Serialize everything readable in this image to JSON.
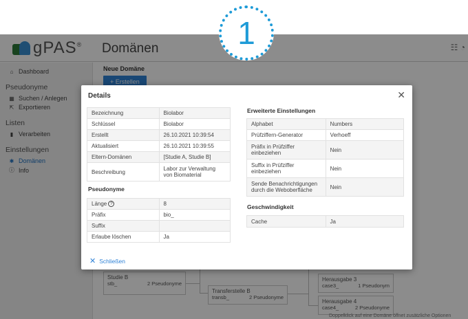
{
  "badge": {
    "number": "1"
  },
  "app": {
    "logo_text": "gPAS",
    "logo_reg": "®",
    "page_title": "Domänen"
  },
  "sidebar": {
    "dashboard": "Dashboard",
    "pseudonyme_section": "Pseudonyme",
    "suchen_anlegen": "Suchen / Anlegen",
    "exportieren": "Exportieren",
    "listen_section": "Listen",
    "verarbeiten": "Verarbeiten",
    "einstellungen_section": "Einstellungen",
    "domaenen": "Domänen",
    "info": "Info"
  },
  "main": {
    "new_domain": "Neue Domäne",
    "create_button": "Erstellen"
  },
  "graph": {
    "studie_b": {
      "name": "Studie B",
      "key": "stb_",
      "count": "2 Pseudonyme"
    },
    "transferstelle_b": {
      "name": "Transferstelle B",
      "key": "transb_",
      "count": "2 Pseudonyme"
    },
    "herausgabe3": {
      "name": "Herausgabe 3",
      "key": "case3_",
      "count": "1 Pseudonym"
    },
    "herausgabe4": {
      "name": "Herausgabe 4",
      "key": "case4_",
      "count": "2 Pseudonyme"
    },
    "bottom_note": "Doppelklick auf eine Domäne öffnet zusätzliche Optionen"
  },
  "modal": {
    "title": "Details",
    "details": [
      {
        "label": "Bezeichnung",
        "value": "Biolabor"
      },
      {
        "label": "Schlüssel",
        "value": "Biolabor"
      },
      {
        "label": "Erstellt",
        "value": "26.10.2021 10:39:54"
      },
      {
        "label": "Aktualisiert",
        "value": "26.10.2021 10:39:55"
      },
      {
        "label": "Eltern-Domänen",
        "value": "[Studie A, Studie B]"
      },
      {
        "label": "Beschreibung",
        "value": "Labor zur Verwaltung von Biomaterial"
      }
    ],
    "pseudonyme_title": "Pseudonyme",
    "pseudonyme": [
      {
        "label": "Länge",
        "value": "8"
      },
      {
        "label": "Präfix",
        "value": "bio_"
      },
      {
        "label": "Suffix",
        "value": ""
      },
      {
        "label": "Erlaube löschen",
        "value": "Ja"
      }
    ],
    "erweitert_title": "Erweiterte Einstellungen",
    "erweitert": [
      {
        "label": "Alphabet",
        "value": "Numbers"
      },
      {
        "label": "Prüfziffern-Generator",
        "value": "Verhoeff"
      },
      {
        "label": "Präfix in Prüfziffer einbeziehen",
        "value": "Nein"
      },
      {
        "label": "Suffix in Prüfziffer einbeziehen",
        "value": "Nein"
      },
      {
        "label": "Sende Benachrichtigungen durch die Weboberfläche",
        "value": "Nein"
      }
    ],
    "geschwindigkeit_title": "Geschwindigkeit",
    "geschwindigkeit": [
      {
        "label": "Cache",
        "value": "Ja"
      }
    ],
    "close_label": "Schließen"
  }
}
